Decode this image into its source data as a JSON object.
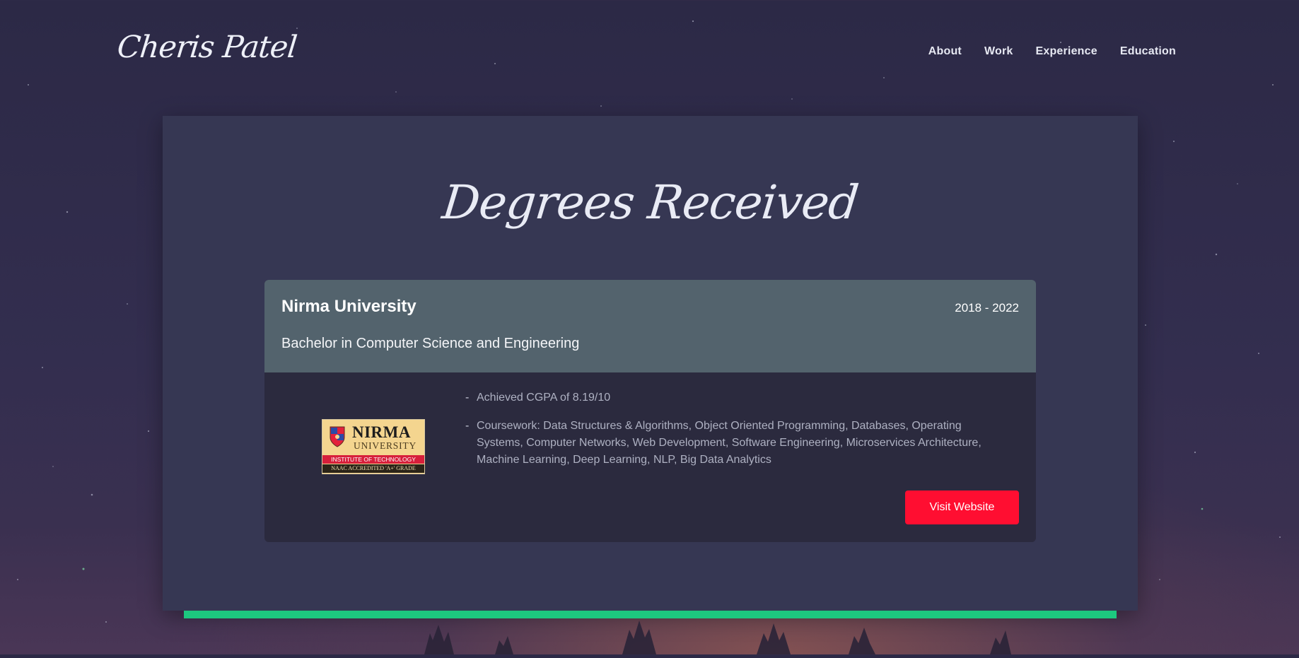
{
  "header": {
    "brand": "Cheris Patel",
    "nav": [
      {
        "label": "About"
      },
      {
        "label": "Work"
      },
      {
        "label": "Experience"
      },
      {
        "label": "Education"
      }
    ]
  },
  "section": {
    "title": "Degrees Received"
  },
  "degree_card": {
    "institution": "Nirma University",
    "years": "2018 - 2022",
    "degree": "Bachelor in Computer Science and Engineering",
    "bullets": [
      "Achieved CGPA of 8.19/10",
      "Coursework: Data Structures & Algorithms, Object Oriented Programming, Databases, Operating Systems, Computer Networks, Web Development, Software Engineering, Microservices Architecture, Machine Learning, Deep Learning, NLP, Big Data Analytics"
    ],
    "button_label": "Visit Website",
    "logo": {
      "name_line": "NIRMA",
      "sub_line": "UNIVERSITY",
      "band_line": "INSTITUTE OF TECHNOLOGY",
      "footer_line": "NAAC ACCREDITED 'A+' GRADE"
    }
  },
  "colors": {
    "accent_green": "#1dc87f",
    "button_red": "#ff0e31",
    "panel": "#363753",
    "card_header": "#53636d"
  }
}
